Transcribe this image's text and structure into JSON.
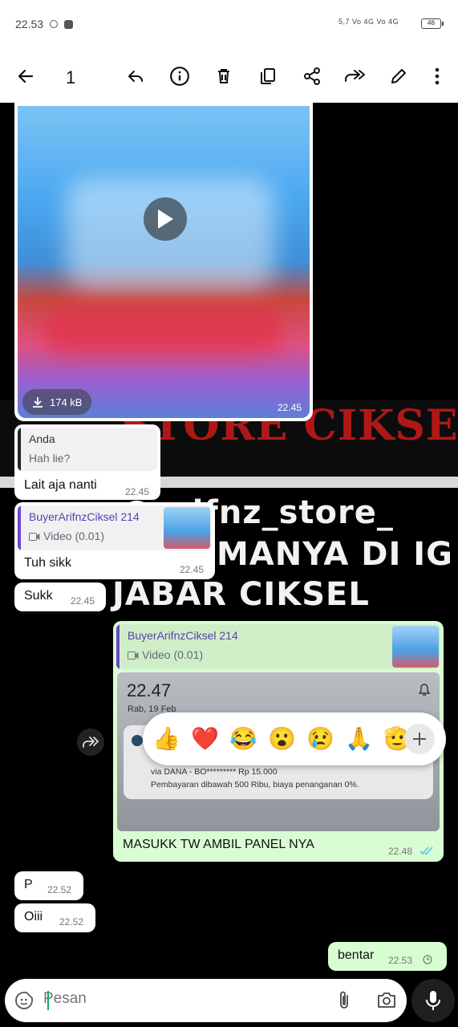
{
  "status": {
    "time": "22.53",
    "network": "5,7 Vo 4G Vo 4G",
    "battery": "46"
  },
  "toolbar": {
    "selected_count": "1",
    "icons": [
      "back-arrow-icon",
      "reply-icon",
      "info-icon",
      "delete-icon",
      "copy-icon",
      "share-icon",
      "forward-icon",
      "edit-icon",
      "more-icon"
    ]
  },
  "wallpaper": {
    "line1": "STORE CIKSE",
    "line2": "@arifnz_store_",
    "line3": "MANYA DI IG",
    "line4": "JABAR CIKSEL"
  },
  "messages": {
    "video": {
      "size": "174 kB",
      "time": "22.45"
    },
    "m1": {
      "quote_name": "Anda",
      "quote_text": "Hah lie?",
      "text": "Lait aja nanti",
      "time": "22.45"
    },
    "m2": {
      "quote_name": "BuyerArifnzCiksel 214",
      "quote_text": "Video (0.01)",
      "text": "Tuh sikk",
      "time": "22.45"
    },
    "m3": {
      "text": "Sukk",
      "time": "22.45"
    },
    "m4": {
      "quote_name": "BuyerArifnzCiksel 214",
      "quote_text": "Video (0.01)",
      "notif_time": "22.47",
      "notif_date": "Rab, 19 Feb",
      "notif_line1": "via DANA - BO********* Rp 15.000",
      "notif_line2": "Pembayaran dibawah 500 Ribu, biaya penanganan 0%.",
      "text": "MASUKK TW AMBIL PANEL NYA",
      "time": "22.48"
    },
    "m5": {
      "text": "P",
      "time": "22.52"
    },
    "m6": {
      "text": "Oiii",
      "time": "22.52"
    },
    "m7": {
      "text": "bentar",
      "time": "22.53"
    }
  },
  "reactions": [
    "👍",
    "❤️",
    "😂",
    "😮",
    "😢",
    "🙏",
    "🫡"
  ],
  "composer": {
    "placeholder": "Pesan"
  },
  "colors": {
    "outgoing": "#d9fdd3",
    "quote_bar_purple": "#6b45c8",
    "tick_blue": "#53bdeb"
  }
}
